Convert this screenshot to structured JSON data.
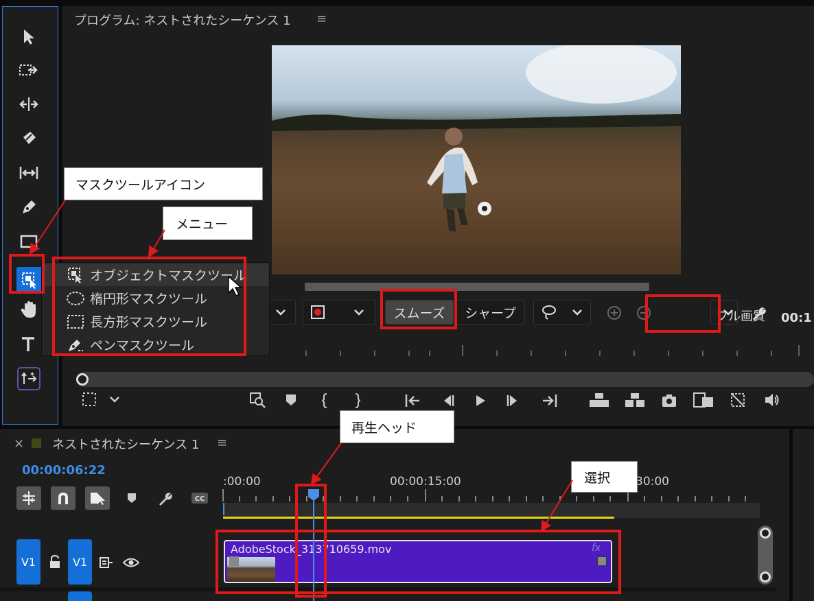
{
  "program_monitor": {
    "title": "プログラム: ネストされたシーケンス 1",
    "menu_glyph": "≡",
    "render_quality_smooth": "スムーズ",
    "render_quality_sharp": "シャープ",
    "playback_quality": "フル画質",
    "timecode_partial": "00:1",
    "video_description": "girl kicking a soccer ball in a field at sunset"
  },
  "mask_menu": {
    "items": [
      {
        "label": "オブジェクトマスクツール",
        "icon": "object-mask-icon"
      },
      {
        "label": "楕円形マスクツール",
        "icon": "ellipse-mask-icon"
      },
      {
        "label": "長方形マスクツール",
        "icon": "rectangle-mask-icon"
      },
      {
        "label": "ペンマスクツール",
        "icon": "pen-mask-icon"
      }
    ]
  },
  "timeline": {
    "close_glyph": "×",
    "title": "ネストされたシーケンス 1",
    "menu_glyph": "≡",
    "current_time": "00:00:06:22",
    "ruler": [
      ":00:00",
      "00:00:15:00",
      "30:00"
    ],
    "tracks": {
      "target_label": "V1",
      "source_label": "V1"
    },
    "clip_name": "AdobeStock_313710659.mov",
    "clip_fx": "fx"
  },
  "annotations": {
    "mask_tool_icon": "マスクツールアイコン",
    "menu": "メニュー",
    "playhead": "再生ヘッド",
    "selection": "選択"
  },
  "colors": {
    "accent_blue": "#1470d8",
    "clip_purple": "#4e1ac2",
    "highlight_red": "#e01a1a",
    "timecode_blue": "#3c8fe6"
  }
}
